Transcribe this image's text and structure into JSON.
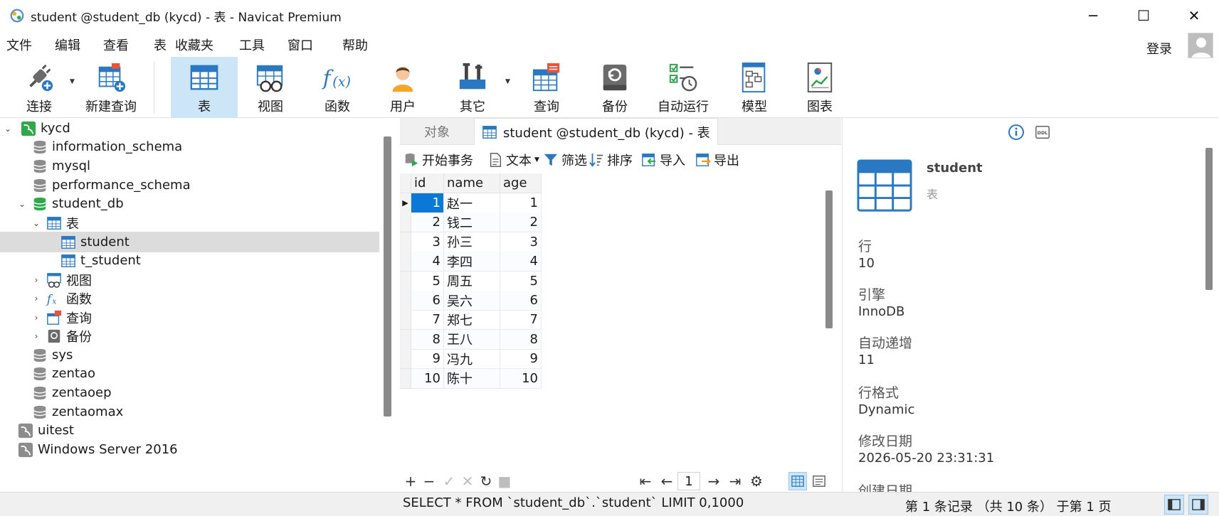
{
  "window": {
    "title": "student @student_db (kycd) - 表 - Navicat Premium",
    "controls": {
      "minimize": "─",
      "maximize": "☐",
      "close": "✕"
    }
  },
  "menu": [
    "文件",
    "编辑",
    "查看",
    "表",
    "收藏夹",
    "工具",
    "窗口",
    "帮助"
  ],
  "login": "登录",
  "toolbar": [
    {
      "label": "连接",
      "icon": "connection-icon"
    },
    {
      "label": "新建查询",
      "icon": "new-query-icon"
    },
    {
      "label": "表",
      "icon": "table-icon",
      "active": true
    },
    {
      "label": "视图",
      "icon": "view-icon"
    },
    {
      "label": "函数",
      "icon": "function-icon"
    },
    {
      "label": "用户",
      "icon": "user-icon"
    },
    {
      "label": "其它",
      "icon": "tools-icon"
    },
    {
      "label": "查询",
      "icon": "query-icon"
    },
    {
      "label": "备份",
      "icon": "backup-icon"
    },
    {
      "label": "自动运行",
      "icon": "schedule-icon"
    },
    {
      "label": "模型",
      "icon": "model-icon"
    },
    {
      "label": "图表",
      "icon": "chart-icon"
    }
  ],
  "tree": [
    {
      "label": "kycd",
      "level": 0,
      "kind": "connection",
      "expanded": true
    },
    {
      "label": "information_schema",
      "level": 1,
      "kind": "database"
    },
    {
      "label": "mysql",
      "level": 1,
      "kind": "database"
    },
    {
      "label": "performance_schema",
      "level": 1,
      "kind": "database"
    },
    {
      "label": "student_db",
      "level": 1,
      "kind": "database-open",
      "expanded": true
    },
    {
      "label": "表",
      "level": 2,
      "kind": "tables",
      "expanded": true
    },
    {
      "label": "student",
      "level": 3,
      "kind": "table",
      "selected": true
    },
    {
      "label": "t_student",
      "level": 3,
      "kind": "table"
    },
    {
      "label": "视图",
      "level": 2,
      "kind": "views",
      "collapsed": true
    },
    {
      "label": "函数",
      "level": 2,
      "kind": "functions",
      "collapsed": true
    },
    {
      "label": "查询",
      "level": 2,
      "kind": "queries",
      "collapsed": true
    },
    {
      "label": "备份",
      "level": 2,
      "kind": "backups",
      "collapsed": true
    },
    {
      "label": "sys",
      "level": 1,
      "kind": "database"
    },
    {
      "label": "zentao",
      "level": 1,
      "kind": "database"
    },
    {
      "label": "zentaoep",
      "level": 1,
      "kind": "database"
    },
    {
      "label": "zentaomax",
      "level": 1,
      "kind": "database"
    },
    {
      "label": "uitest",
      "level": 0,
      "kind": "connection-off"
    },
    {
      "label": "Windows Server 2016",
      "level": 0,
      "kind": "connection-off"
    }
  ],
  "tabs": {
    "objects": "对象",
    "current": "student @student_db (kycd) - 表"
  },
  "subtoolbar": {
    "begin_tx": "开始事务",
    "text": "文本",
    "filter": "筛选",
    "sort": "排序",
    "import": "导入",
    "export": "导出"
  },
  "grid": {
    "columns": [
      "id",
      "name",
      "age"
    ],
    "rows": [
      [
        "1",
        "赵一",
        "1"
      ],
      [
        "2",
        "钱二",
        "2"
      ],
      [
        "3",
        "孙三",
        "3"
      ],
      [
        "4",
        "李四",
        "4"
      ],
      [
        "5",
        "周五",
        "5"
      ],
      [
        "6",
        "吴六",
        "6"
      ],
      [
        "7",
        "郑七",
        "7"
      ],
      [
        "8",
        "王八",
        "8"
      ],
      [
        "9",
        "冯九",
        "9"
      ],
      [
        "10",
        "陈十",
        "10"
      ]
    ]
  },
  "pager": {
    "page": "1"
  },
  "info": {
    "name": "student",
    "type": "表",
    "fields": [
      {
        "label": "行",
        "value": "10"
      },
      {
        "label": "引擎",
        "value": "InnoDB"
      },
      {
        "label": "自动递增",
        "value": "11"
      },
      {
        "label": "行格式",
        "value": "Dynamic"
      },
      {
        "label": "修改日期",
        "value": "2026-05-20 23:31:31"
      },
      {
        "label": "创建日期",
        "value": ""
      }
    ]
  },
  "status": {
    "sql": "SELECT * FROM `student_db`.`student` LIMIT 0,1000",
    "records": "第 1 条记录 （共 10 条） 于第 1 页"
  },
  "colors": {
    "accent": "#0a78d7",
    "active_bg": "#cde6f7",
    "table_blue": "#2b78c2"
  }
}
